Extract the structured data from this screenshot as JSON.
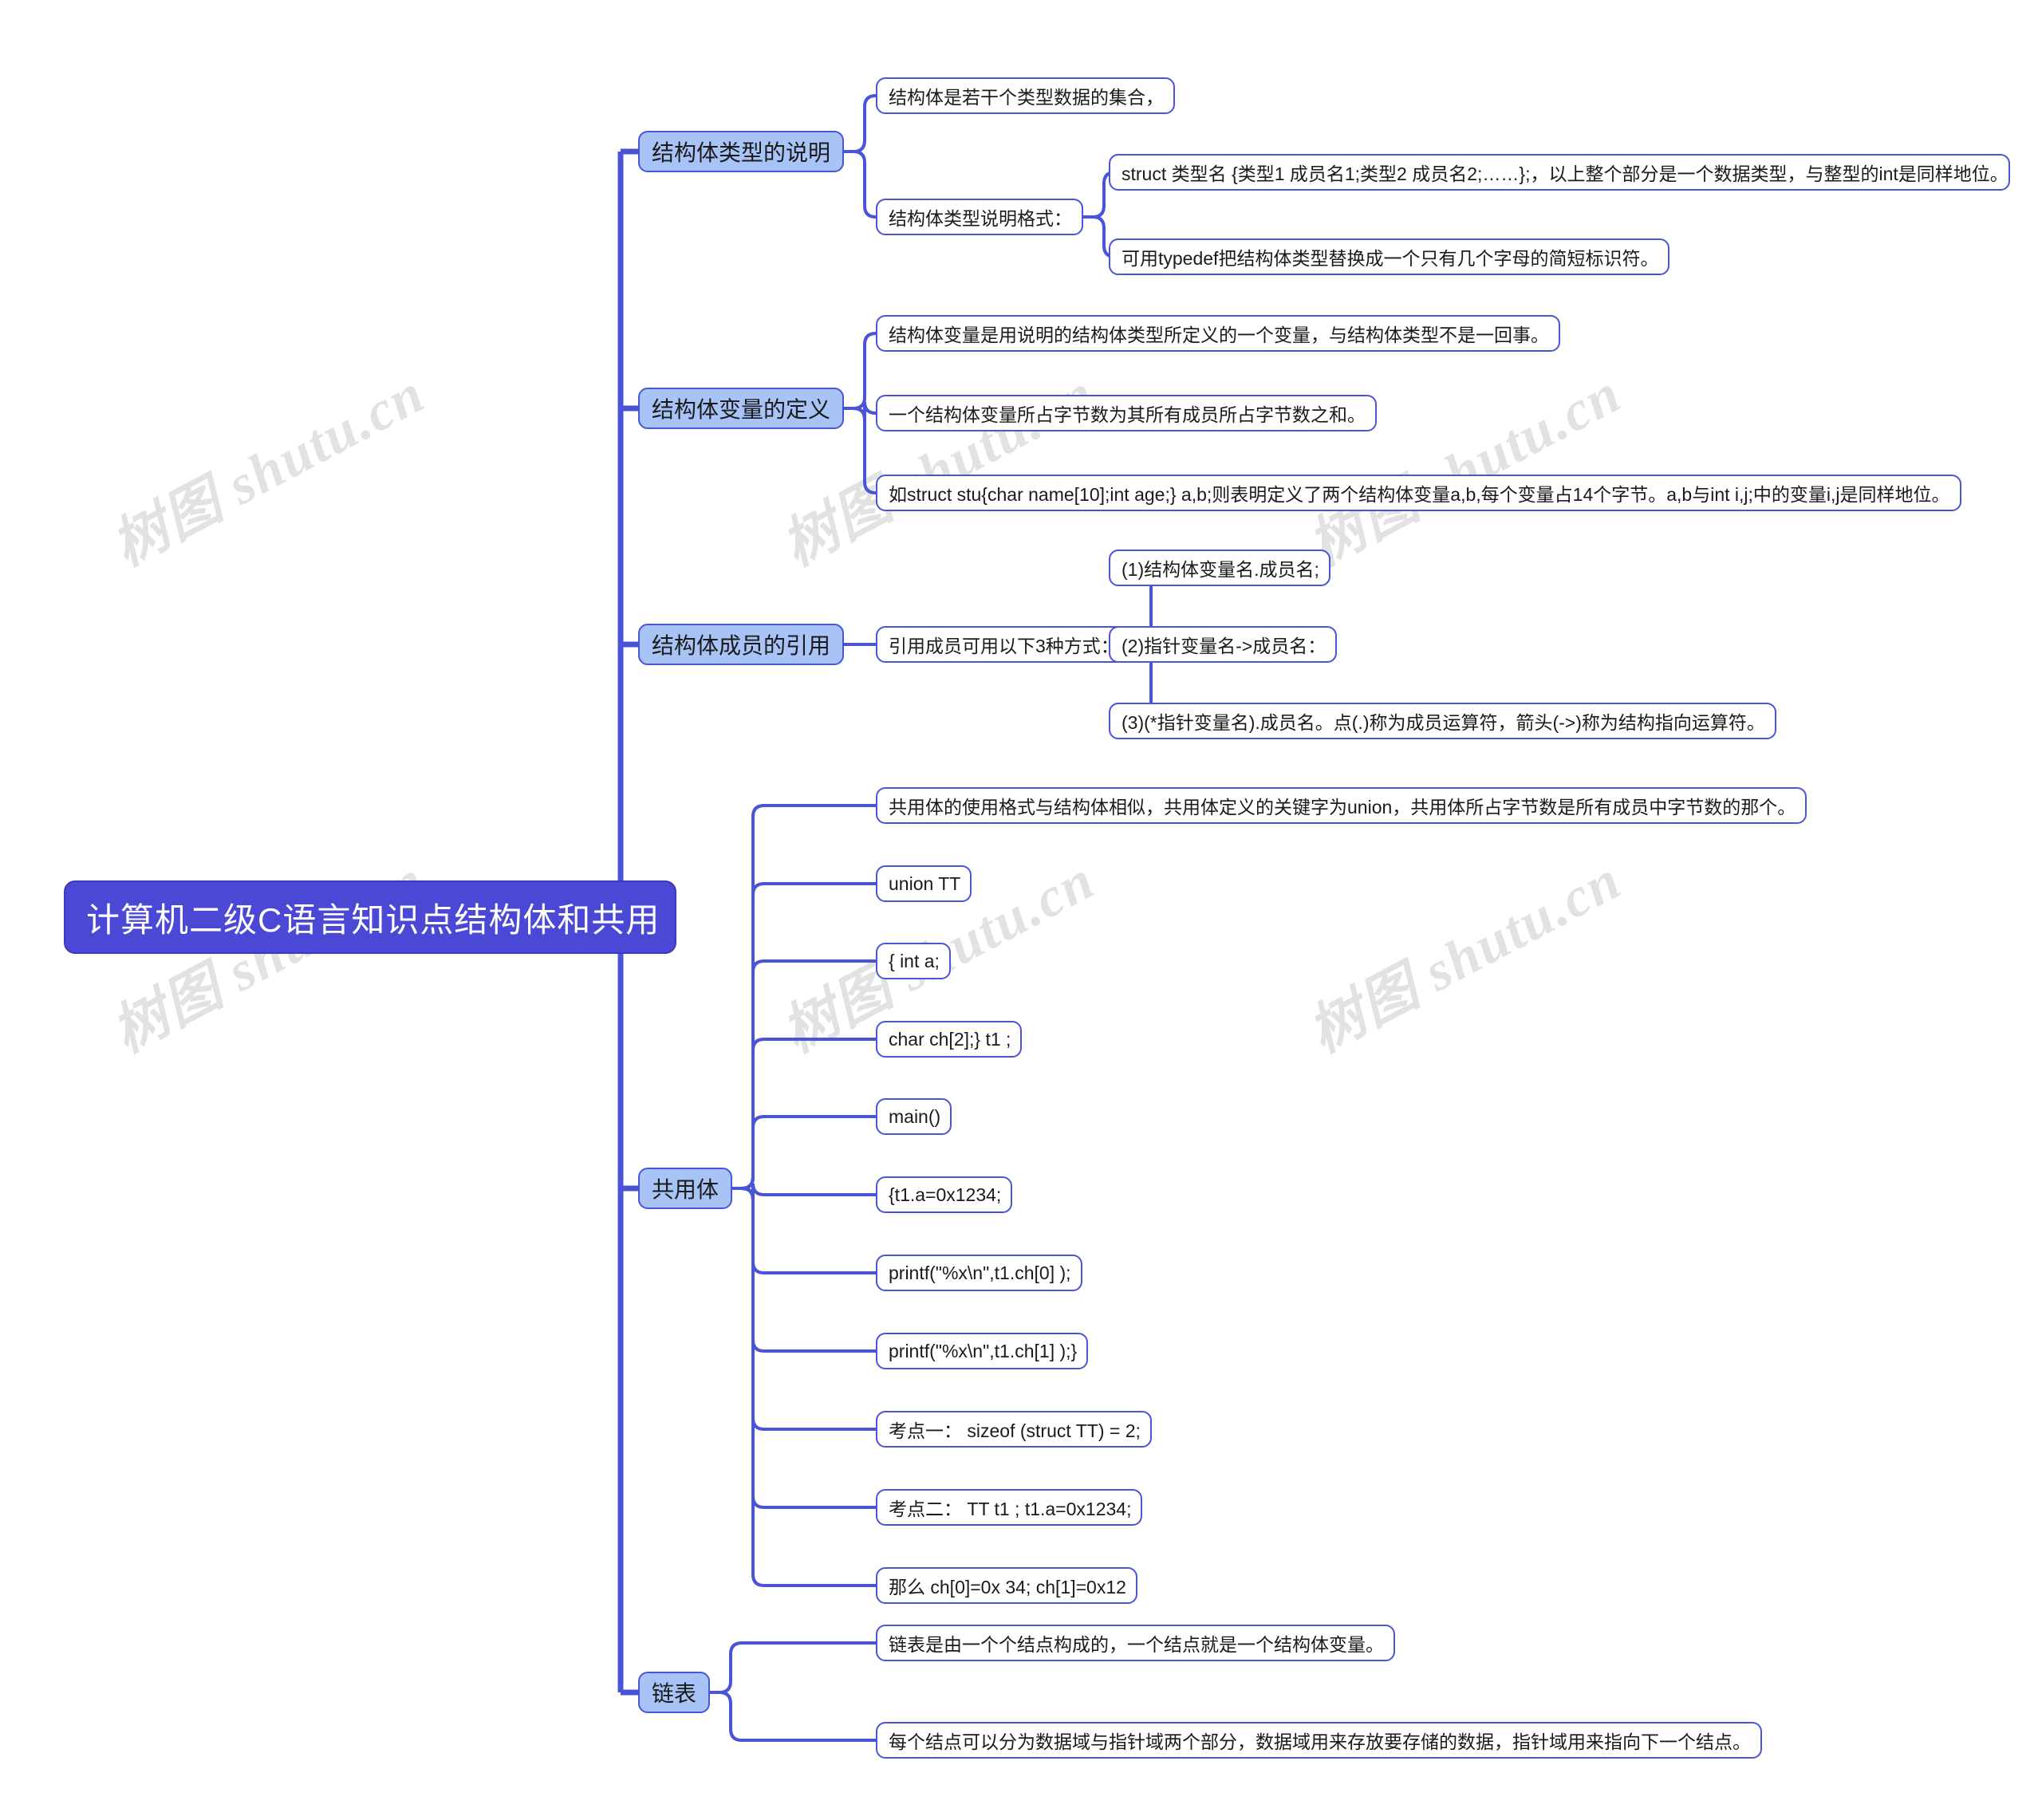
{
  "title": "计算机二级C语言知识点结构体和共用",
  "watermark": "树图 shutu.cn",
  "colors": {
    "root_fill": "#4a48d4",
    "branch_fill": "#a8c4f7",
    "stroke": "#4a54d6",
    "leaf_fill": "#ffffff",
    "watermark": "#e2e2e2"
  },
  "root": {
    "label": "计算机二级C语言知识点结构体和共用"
  },
  "branches": [
    {
      "label": "结构体类型的说明",
      "children": [
        {
          "label": "结构体是若干个类型数据的集合，",
          "children": []
        },
        {
          "label": "结构体类型说明格式：",
          "children": [
            {
              "label": "struct 类型名 {类型1 成员名1;类型2 成员名2;……};，以上整个部分是一个数据类型，与整型的int是同样地位。"
            },
            {
              "label": "可用typedef把结构体类型替换成一个只有几个字母的简短标识符。"
            }
          ]
        }
      ]
    },
    {
      "label": "结构体变量的定义",
      "children": [
        {
          "label": "结构体变量是用说明的结构体类型所定义的一个变量，与结构体类型不是一回事。",
          "children": []
        },
        {
          "label": "一个结构体变量所占字节数为其所有成员所占字节数之和。",
          "children": []
        },
        {
          "label": "如struct stu{char name[10];int age;} a,b;则表明定义了两个结构体变量a,b,每个变量占14个字节。a,b与int i,j;中的变量i,j是同样地位。",
          "children": []
        }
      ]
    },
    {
      "label": "结构体成员的引用",
      "children": [
        {
          "label": "引用成员可用以下3种方式：",
          "children": [
            {
              "label": "(1)结构体变量名.成员名;"
            },
            {
              "label": "(2)指针变量名->成员名："
            },
            {
              "label": "(3)(*指针变量名).成员名。点(.)称为成员运算符，箭头(->)称为结构指向运算符。"
            }
          ]
        }
      ]
    },
    {
      "label": "共用体",
      "children": [
        {
          "label": "共用体的使用格式与结构体相似，共用体定义的关键字为union，共用体所占字节数是所有成员中字节数的那个。",
          "children": []
        },
        {
          "label": "union TT",
          "children": []
        },
        {
          "label": "{ int a;",
          "children": []
        },
        {
          "label": "char ch[2];} t1 ;",
          "children": []
        },
        {
          "label": "main()",
          "children": []
        },
        {
          "label": "{t1.a=0x1234;",
          "children": []
        },
        {
          "label": "printf(\"%x\\n\",t1.ch[0] );",
          "children": []
        },
        {
          "label": "printf(\"%x\\n\",t1.ch[1] );}",
          "children": []
        },
        {
          "label": "考点一：  sizeof (struct TT) = 2;",
          "children": []
        },
        {
          "label": "考点二：  TT t1 ; t1.a=0x1234;",
          "children": []
        },
        {
          "label": "那么 ch[0]=0x 34; ch[1]=0x12",
          "children": []
        }
      ]
    },
    {
      "label": "链表",
      "children": [
        {
          "label": "链表是由一个个结点构成的，一个结点就是一个结构体变量。",
          "children": []
        },
        {
          "label": "每个结点可以分为数据域与指针域两个部分，数据域用来存放要存储的数据，指针域用来指向下一个结点。",
          "children": []
        }
      ]
    }
  ]
}
